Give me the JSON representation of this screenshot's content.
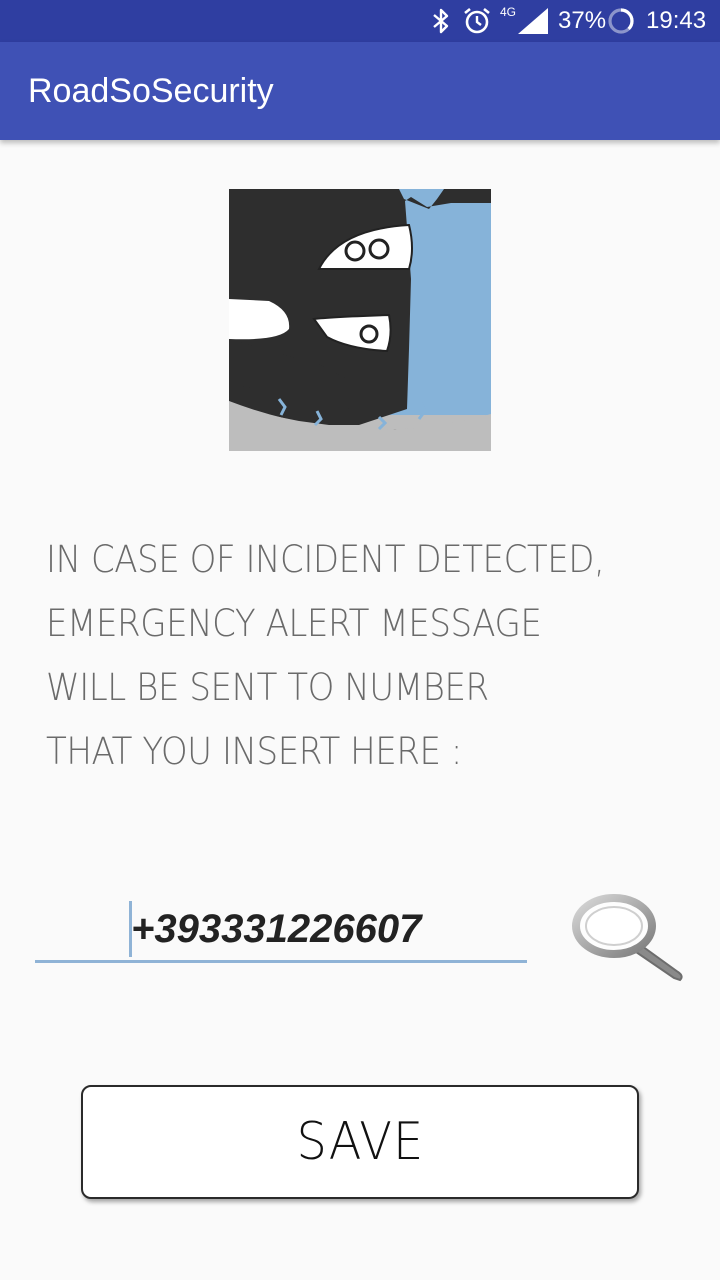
{
  "status_bar": {
    "signal_label": "4G",
    "battery_percent": "37%",
    "time": "19:43",
    "icons": [
      "bluetooth-icon",
      "alarm-icon",
      "signal-icon",
      "battery-icon"
    ]
  },
  "app_bar": {
    "title": "RoadSoSecurity"
  },
  "main": {
    "logo_icon": "roadsosecurity-logo-icon",
    "message_lines": [
      "IN CASE OF INCIDENT DETECTED,",
      "EMERGENCY ALERT MESSAGE",
      "WILL BE SENT TO NUMBER",
      "THAT YOU INSERT HERE :"
    ],
    "phone_input": {
      "value": "+393331226607"
    },
    "search_icon": "magnifier-icon",
    "save_label": "SAVE"
  },
  "colors": {
    "status_bar": "#2f3ea1",
    "app_bar": "#3f51b5",
    "background": "#fafafa",
    "input_underline": "#8fb3d6",
    "message_text": "#6a6a6a"
  }
}
